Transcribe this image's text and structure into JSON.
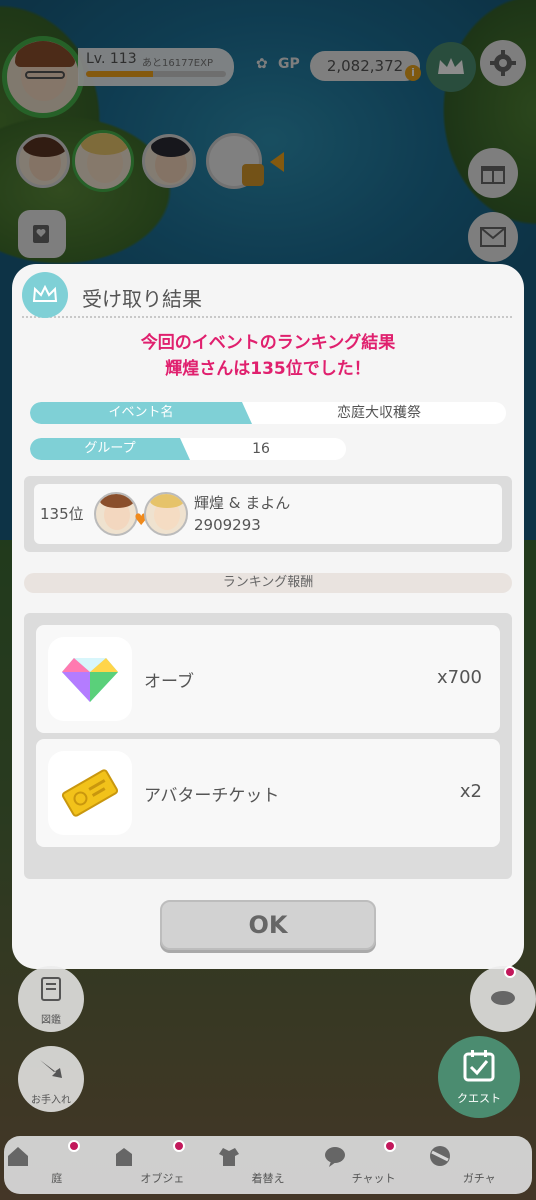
{
  "hud": {
    "level_label": "Lv. 113",
    "exp_remaining": "あと16177EXP",
    "exp_progress_percent": 48,
    "gp_label": "GP",
    "gp_value": "2,082,372",
    "gp_plus": "i"
  },
  "dialog": {
    "title": "受け取り結果",
    "result_line1": "今回のイベントのランキング結果",
    "result_line2": "輝煌さんは135位でした！",
    "event_label": "イベント名",
    "event_value": "恋庭大収穫祭",
    "group_label": "グループ",
    "group_value": "16",
    "rank_position": "135位",
    "pair_name": "輝煌 & まよん",
    "pair_score": "2909293",
    "reward_section_title": "ランキング報酬",
    "rewards": [
      {
        "name": "オーブ",
        "qty": "x700",
        "icon": "gem-icon"
      },
      {
        "name": "アバターチケット",
        "qty": "x2",
        "icon": "ticket-icon"
      }
    ],
    "ok_label": "OK"
  },
  "side": {
    "zukan_label": "図鑑",
    "oteire_label": "お手入れ",
    "quest_label": "クエスト"
  },
  "nav": [
    {
      "label": "庭",
      "icon": "home-icon"
    },
    {
      "label": "オブジェ",
      "icon": "object-icon"
    },
    {
      "label": "着替え",
      "icon": "wardrobe-icon"
    },
    {
      "label": "チャット",
      "icon": "chat-icon"
    },
    {
      "label": "ガチャ",
      "icon": "gacha-icon"
    }
  ],
  "colors": {
    "accent_teal": "#7fd0d6",
    "result_pink": "#e0206e",
    "level_green": "#46b14a",
    "exp_orange": "#f0a21b",
    "notification_dot": "#c2185b"
  }
}
